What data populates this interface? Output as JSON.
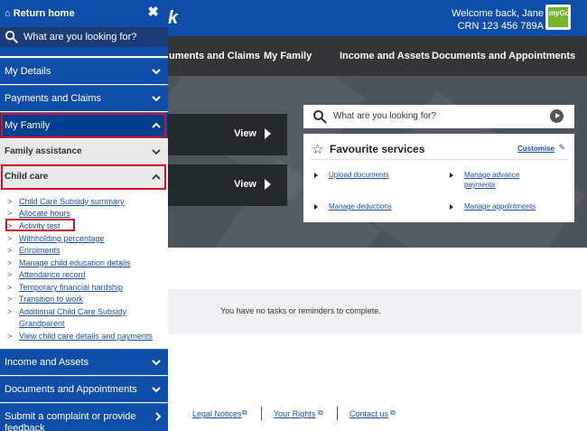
{
  "header": {
    "brand_fragment": "k",
    "welcome": "Welcome back, Jane",
    "crn": "CRN 123 456 789A",
    "logo_text": "myGov"
  },
  "nav": {
    "items": [
      "uments and Claims",
      "My Family",
      "Income and Assets",
      "Documents and Appointments"
    ]
  },
  "hero": {
    "view_label": "View",
    "search_placeholder": "What are you looking for?",
    "favourites": {
      "title": "Favourite services",
      "customise": "Customise",
      "links": [
        "Upload documents",
        "Manage advance payments",
        "Manage deductions",
        "Manage appointments"
      ]
    }
  },
  "tasks": {
    "message": "You have no tasks or reminders to complete."
  },
  "footer": {
    "links": [
      "Legal Notices",
      "Your Rights",
      "Contact us"
    ]
  },
  "sidebar": {
    "return_home": "Return home",
    "search_placeholder": "What are you looking for?",
    "sections": [
      {
        "label": "My Details"
      },
      {
        "label": "Payments and Claims"
      },
      {
        "label": "My Family"
      }
    ],
    "family_assistance": "Family assistance",
    "child_care": "Child care",
    "child_care_links": [
      "Child Care Subsidy summary",
      "Allocate hours",
      "Activity test",
      "Withholding percentage",
      "Enrolments",
      "Manage child education details",
      "Attendance record",
      "Temporary financial hardship",
      "Transition to work",
      "Additional Child Care Subsidy",
      "Grandparent",
      "View child care details and payments"
    ],
    "bottom_sections": [
      {
        "label": "Income and Assets"
      },
      {
        "label": "Documents and Appointments"
      },
      {
        "label": "Submit a complaint or provide"
      },
      {
        "label": "feedback"
      }
    ]
  },
  "colors": {
    "brand_blue": "#0f4ea8",
    "dark_nav": "#333537",
    "highlight_red": "#d6122a",
    "link_blue": "#1d4f9c",
    "mygov_green": "#74b52a"
  }
}
